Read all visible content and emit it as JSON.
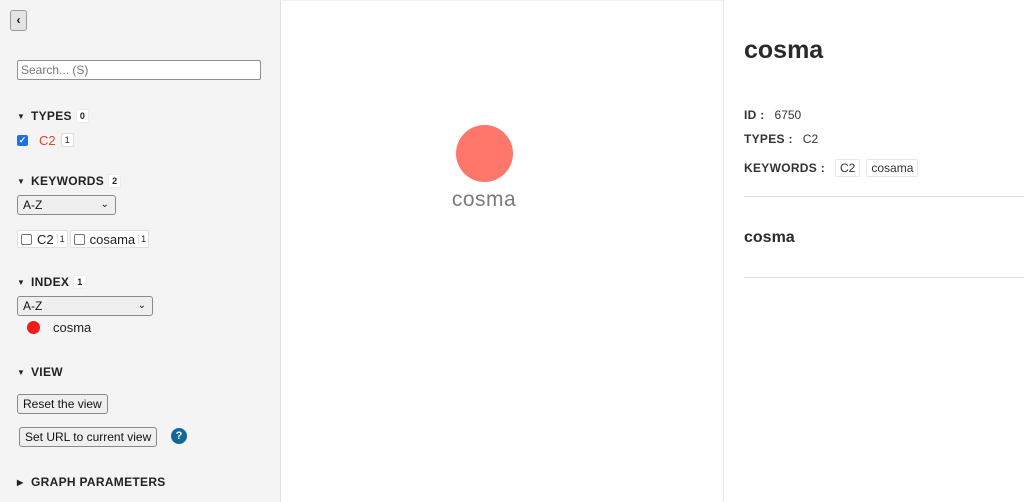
{
  "menu": {
    "toggle_icon": "‹",
    "search_placeholder": "Search... (S)",
    "types": {
      "title": "TYPES",
      "count": "0",
      "items": [
        {
          "label": "C2",
          "count": "1",
          "checked": true
        }
      ]
    },
    "keywords": {
      "title": "KEYWORDS",
      "count": "2",
      "sort": "A-Z",
      "items": [
        {
          "label": "C2",
          "count": "1"
        },
        {
          "label": "cosama",
          "count": "1"
        }
      ]
    },
    "index": {
      "title": "INDEX",
      "count": "1",
      "sort": "A-Z",
      "items": [
        {
          "label": "cosma",
          "color": "#ee1c1c"
        }
      ]
    },
    "view": {
      "title": "VIEW",
      "reset_label": "Reset the view",
      "set_url_label": "Set URL to current view",
      "help_glyph": "?"
    },
    "graph_parameters": {
      "title": "GRAPH PARAMETERS"
    }
  },
  "graph": {
    "nodes": [
      {
        "label": "cosma",
        "color": "#ff776a"
      }
    ]
  },
  "record": {
    "title": "cosma",
    "id_label": "ID :",
    "id_value": "6750",
    "types_label": "TYPES :",
    "types_value": "C2",
    "keywords_label": "KEYWORDS :",
    "keywords": [
      "C2",
      "cosama"
    ],
    "subtitle": "cosma"
  },
  "colors": {
    "type_c2": "#e7402b",
    "node": "#ff776a",
    "help": "#14679b"
  }
}
